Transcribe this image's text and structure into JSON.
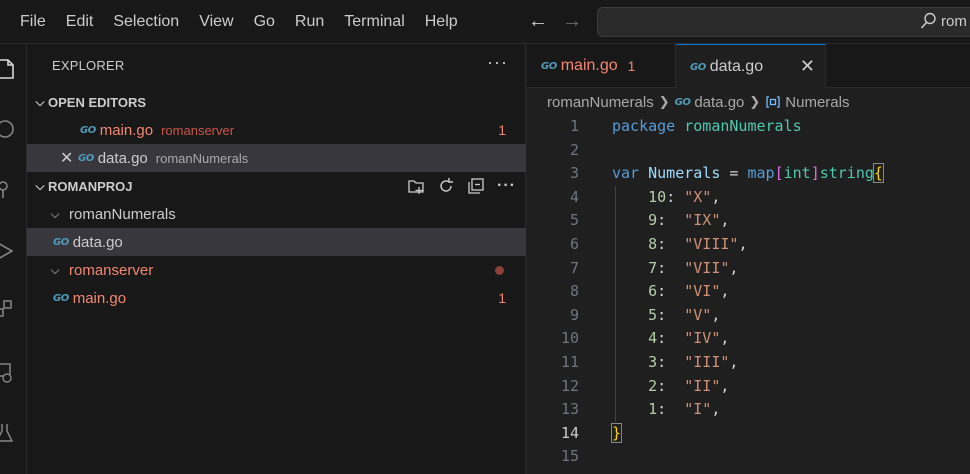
{
  "menu": [
    "File",
    "Edit",
    "Selection",
    "View",
    "Go",
    "Run",
    "Terminal",
    "Help"
  ],
  "command_center": {
    "text": "rom"
  },
  "icons": {
    "back": "←",
    "forward": "→"
  },
  "explorer": {
    "title": "EXPLORER",
    "more": "···",
    "open_editors": {
      "label": "OPEN EDITORS",
      "items": [
        {
          "name": "main.go",
          "desc": "romanserver",
          "badge": "1"
        },
        {
          "name": "data.go",
          "desc": "romanNumerals"
        }
      ]
    },
    "project": {
      "label": "ROMANPROJ",
      "folder1": "romanNumerals",
      "folder1_file": "data.go",
      "folder2": "romanserver",
      "folder2_file": "main.go",
      "folder2_file_badge": "1"
    }
  },
  "tabs": [
    {
      "label": "main.go",
      "badge": "1"
    },
    {
      "label": "data.go"
    }
  ],
  "breadcrumb": [
    "romanNumerals",
    "data.go",
    "Numerals"
  ],
  "go_icon": "GO",
  "code": {
    "line_numbers": [
      "1",
      "2",
      "3",
      "4",
      "5",
      "6",
      "7",
      "8",
      "9",
      "10",
      "11",
      "12",
      "13",
      "14",
      "15"
    ],
    "pkg_kw": "package",
    "pkg_name": "romanNumerals",
    "var_kw": "var",
    "var_name": "Numerals",
    "eq": " = ",
    "map_kw": "map",
    "key_type": "int",
    "val_type": "string",
    "entries": [
      {
        "k": "10",
        "v": "\"X\""
      },
      {
        "k": "9",
        "v": "\"IX\""
      },
      {
        "k": "8",
        "v": "\"VIII\""
      },
      {
        "k": "7",
        "v": "\"VII\""
      },
      {
        "k": "6",
        "v": "\"VI\""
      },
      {
        "k": "5",
        "v": "\"V\""
      },
      {
        "k": "4",
        "v": "\"IV\""
      },
      {
        "k": "3",
        "v": "\"III\""
      },
      {
        "k": "2",
        "v": "\"II\""
      },
      {
        "k": "1",
        "v": "\"I\""
      }
    ],
    "close_brace": "}"
  }
}
